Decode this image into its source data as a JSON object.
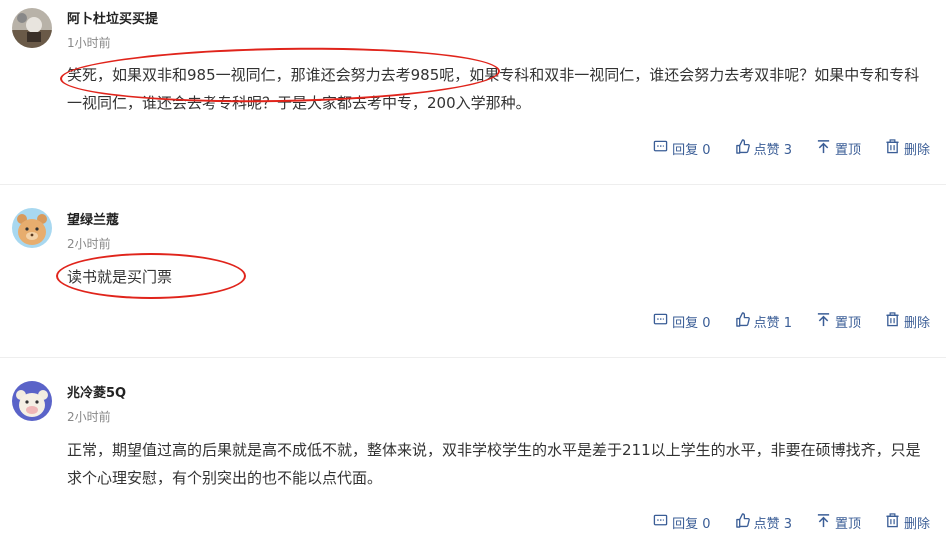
{
  "comments": [
    {
      "username": "阿卜杜垃买买提",
      "time": "1小时前",
      "text": "笑死，如果双非和985一视同仁，那谁还会努力去考985呢，如果专科和双非一视同仁，谁还会努力去考双非呢？如果中专和专科一视同仁，谁还会去考专科呢？于是大家都去考中专，200入学那种。",
      "reply_label": "回复 0",
      "like_label": "点赞 3",
      "pin_label": "置顶",
      "delete_label": "删除"
    },
    {
      "username": "望绿兰蔻",
      "time": "2小时前",
      "text": "读书就是买门票",
      "reply_label": "回复 0",
      "like_label": "点赞 1",
      "pin_label": "置顶",
      "delete_label": "删除"
    },
    {
      "username": "兆冷菱5Q",
      "time": "2小时前",
      "text": "正常，期望值过高的后果就是高不成低不就，整体来说，双非学校学生的水平是差于211以上学生的水平，非要在硕博找齐，只是求个心理安慰，有个别突出的也不能以点代面。",
      "reply_label": "回复 0",
      "like_label": "点赞 3",
      "pin_label": "置顶",
      "delete_label": "删除"
    }
  ],
  "colors": {
    "accent": "#3a5d96",
    "annotation": "#e0241b"
  },
  "icons": [
    "reply-icon",
    "thumbs-up-icon",
    "pin-top-icon",
    "trash-icon"
  ]
}
